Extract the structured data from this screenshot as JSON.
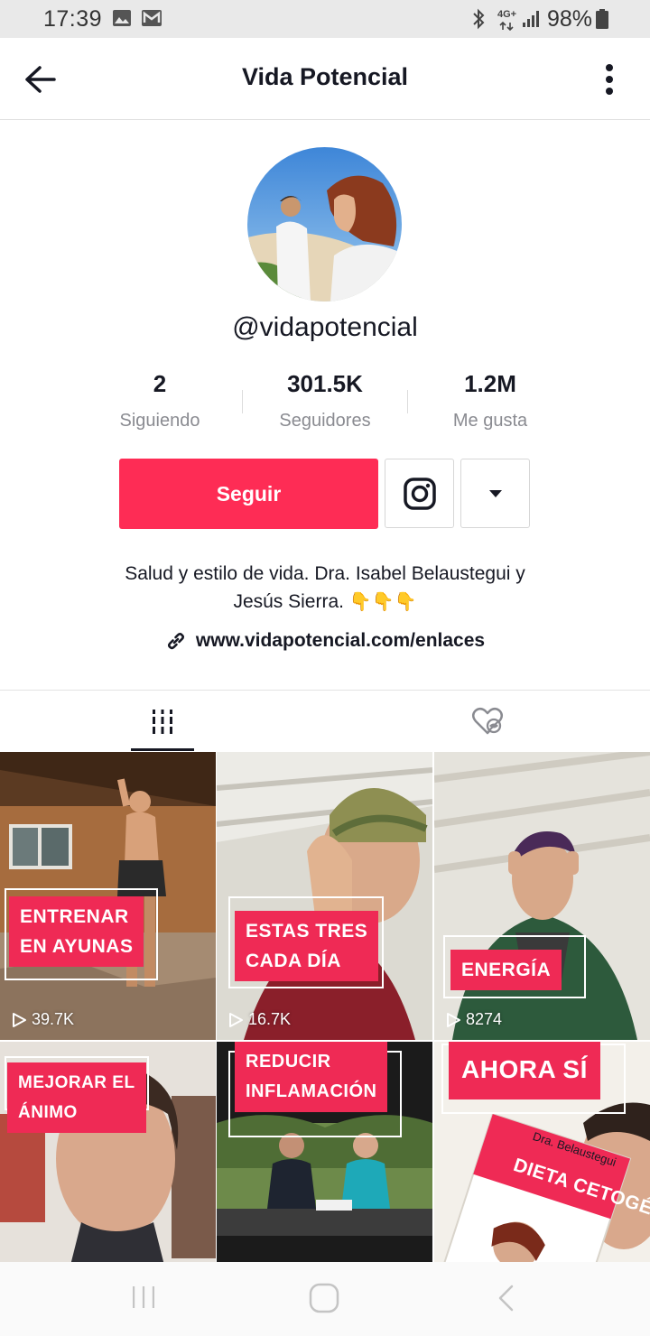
{
  "status_bar": {
    "time": "17:39",
    "network": "4G+",
    "battery": "98%"
  },
  "header": {
    "title": "Vida Potencial",
    "back_icon": "arrow-left-icon",
    "menu_icon": "more-vertical-icon"
  },
  "profile": {
    "handle": "@vidapotencial",
    "stats": [
      {
        "value": "2",
        "label": "Siguiendo"
      },
      {
        "value": "301.5K",
        "label": "Seguidores"
      },
      {
        "value": "1.2M",
        "label": "Me gusta"
      }
    ],
    "follow_label": "Seguir",
    "bio_line1": "Salud y estilo de vida. Dra. Isabel Belaustegui y",
    "bio_line2": "Jesús Sierra.",
    "bio_emoji": "👇👇👇",
    "link": "www.vidapotencial.com/enlaces"
  },
  "tabs": [
    {
      "icon": "videos-grid-icon",
      "active": true
    },
    {
      "icon": "liked-hidden-icon",
      "active": false
    }
  ],
  "videos": [
    {
      "caption_line1": "ENTRENAR",
      "caption_line2": "EN AYUNAS",
      "views": "39.7K"
    },
    {
      "caption_line1": "ESTAS TRES",
      "caption_line2": "CADA DÍA",
      "views": "16.7K"
    },
    {
      "caption_line1": "ENERGÍA",
      "caption_line2": "",
      "views": "8274"
    },
    {
      "caption_line1": "MEJORAR EL",
      "caption_line2": "ÁNIMO",
      "views": ""
    },
    {
      "caption_line1": "REDUCIR",
      "caption_line2": "INFLAMACIÓN",
      "views": ""
    },
    {
      "caption_line1": "AHORA SÍ",
      "caption_line2": "",
      "views": "",
      "book_title": "DIETA CETOGÉNICA",
      "book_author": "Dra. Belaustegui"
    }
  ],
  "colors": {
    "accent": "#fe2c55",
    "caption": "#ef2a55",
    "text_primary": "#161823",
    "text_secondary": "#8a8b91"
  }
}
